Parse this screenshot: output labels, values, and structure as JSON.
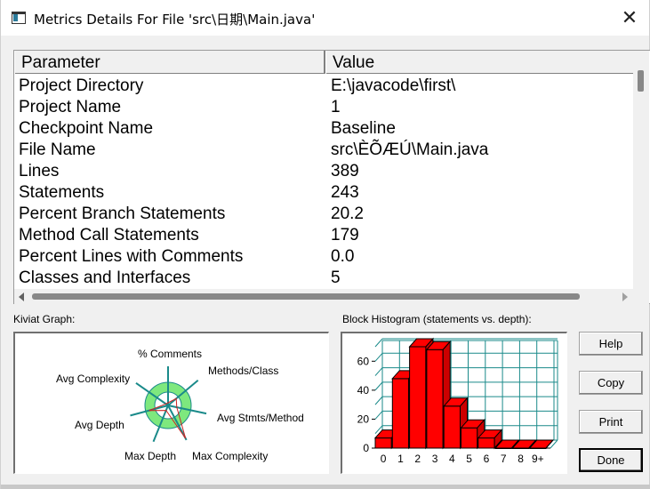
{
  "window": {
    "title": "Metrics Details For File 'src\\日期\\Main.java'",
    "close_glyph": "✕"
  },
  "metrics_list": {
    "columns": [
      "Parameter",
      "Value"
    ],
    "rows": [
      {
        "parameter": "Project Directory",
        "value": "E:\\javacode\\first\\"
      },
      {
        "parameter": "Project Name",
        "value": "1"
      },
      {
        "parameter": "Checkpoint Name",
        "value": "Baseline"
      },
      {
        "parameter": "File Name",
        "value": "src\\ÈÕÆÚ\\Main.java"
      },
      {
        "parameter": "Lines",
        "value": "389"
      },
      {
        "parameter": "Statements",
        "value": "243"
      },
      {
        "parameter": "Percent Branch Statements",
        "value": "20.2"
      },
      {
        "parameter": "Method Call Statements",
        "value": "179"
      },
      {
        "parameter": "Percent Lines with Comments",
        "value": "0.0"
      },
      {
        "parameter": "Classes and Interfaces",
        "value": "5"
      }
    ]
  },
  "kiviat": {
    "label": "Kiviat Graph:",
    "axes": [
      {
        "name": "% Comments"
      },
      {
        "name": "Methods/Class"
      },
      {
        "name": "Avg Stmts/Method"
      },
      {
        "name": "Max Complexity"
      },
      {
        "name": "Max Depth"
      },
      {
        "name": "Avg Depth"
      },
      {
        "name": "Avg Complexity"
      }
    ],
    "colors": {
      "ring": "#7ee87e",
      "inner": "#ffffff",
      "spoke": "#1a8a8a",
      "plot": "#cc2222"
    }
  },
  "histogram": {
    "label": "Block Histogram (statements vs. depth):",
    "colors": {
      "bar": "#ff0000",
      "grid": "#1a8a8a",
      "axis": "#000000"
    }
  },
  "chart_data": {
    "type": "bar",
    "title": "Block Histogram (statements vs. depth):",
    "categories": [
      "0",
      "1",
      "2",
      "3",
      "4",
      "5",
      "6",
      "7",
      "8",
      "9+"
    ],
    "values": [
      7,
      48,
      70,
      68,
      29,
      14,
      7,
      0,
      0,
      0
    ],
    "y_ticks": [
      "0",
      "20",
      "40",
      "60"
    ],
    "ylim": [
      0,
      70
    ],
    "grid": true
  },
  "buttons": {
    "help": "Help",
    "copy": "Copy",
    "print": "Print",
    "done": "Done"
  }
}
